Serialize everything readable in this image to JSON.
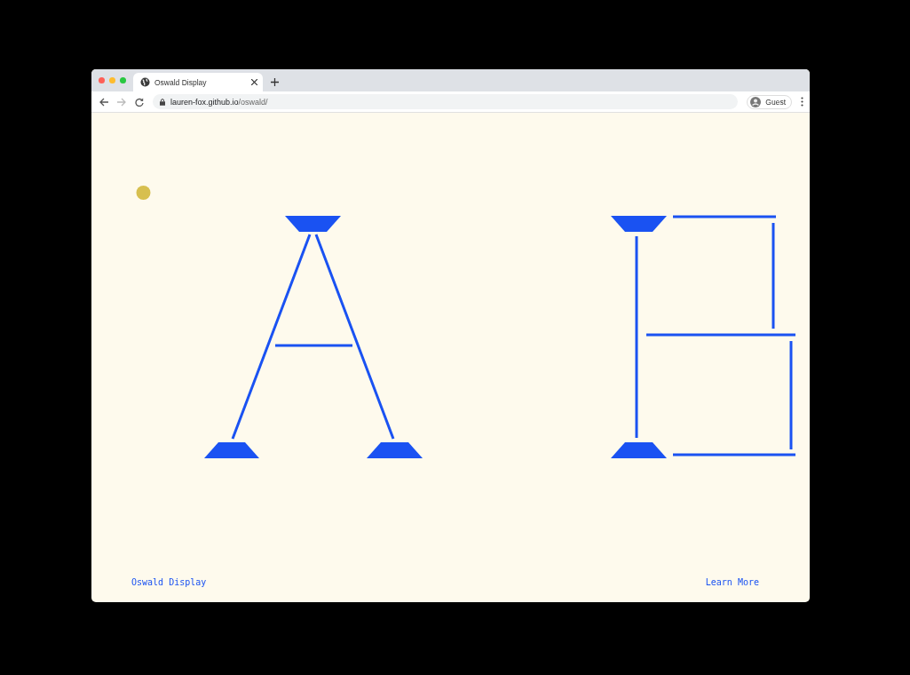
{
  "window": {
    "tab": {
      "title": "Oswald Display",
      "selected": true
    },
    "url": {
      "host": "lauren-fox.github.io",
      "path": "/oswald/"
    },
    "profile": "Guest"
  },
  "footer": {
    "left_link": "Oswald Display",
    "right_link": "Learn More"
  }
}
